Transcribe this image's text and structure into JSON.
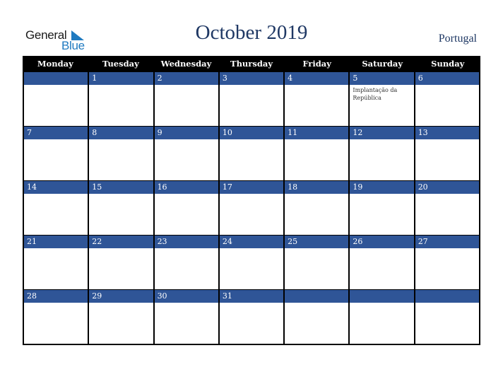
{
  "logo": {
    "general": "General",
    "blue": "Blue"
  },
  "title": "October 2019",
  "country": "Portugal",
  "colors": {
    "header_bg": "#000000",
    "date_band": "#2f5597",
    "title": "#1f3864",
    "logo_blue": "#1f7ac0"
  },
  "weekdays": [
    "Monday",
    "Tuesday",
    "Wednesday",
    "Thursday",
    "Friday",
    "Saturday",
    "Sunday"
  ],
  "weeks": [
    [
      {
        "day": ""
      },
      {
        "day": "1"
      },
      {
        "day": "2"
      },
      {
        "day": "3"
      },
      {
        "day": "4"
      },
      {
        "day": "5",
        "event": "Implantação da República"
      },
      {
        "day": "6"
      }
    ],
    [
      {
        "day": "7"
      },
      {
        "day": "8"
      },
      {
        "day": "9"
      },
      {
        "day": "10"
      },
      {
        "day": "11"
      },
      {
        "day": "12"
      },
      {
        "day": "13"
      }
    ],
    [
      {
        "day": "14"
      },
      {
        "day": "15"
      },
      {
        "day": "16"
      },
      {
        "day": "17"
      },
      {
        "day": "18"
      },
      {
        "day": "19"
      },
      {
        "day": "20"
      }
    ],
    [
      {
        "day": "21"
      },
      {
        "day": "22"
      },
      {
        "day": "23"
      },
      {
        "day": "24"
      },
      {
        "day": "25"
      },
      {
        "day": "26"
      },
      {
        "day": "27"
      }
    ],
    [
      {
        "day": "28"
      },
      {
        "day": "29"
      },
      {
        "day": "30"
      },
      {
        "day": "31"
      },
      {
        "day": ""
      },
      {
        "day": ""
      },
      {
        "day": ""
      }
    ]
  ]
}
